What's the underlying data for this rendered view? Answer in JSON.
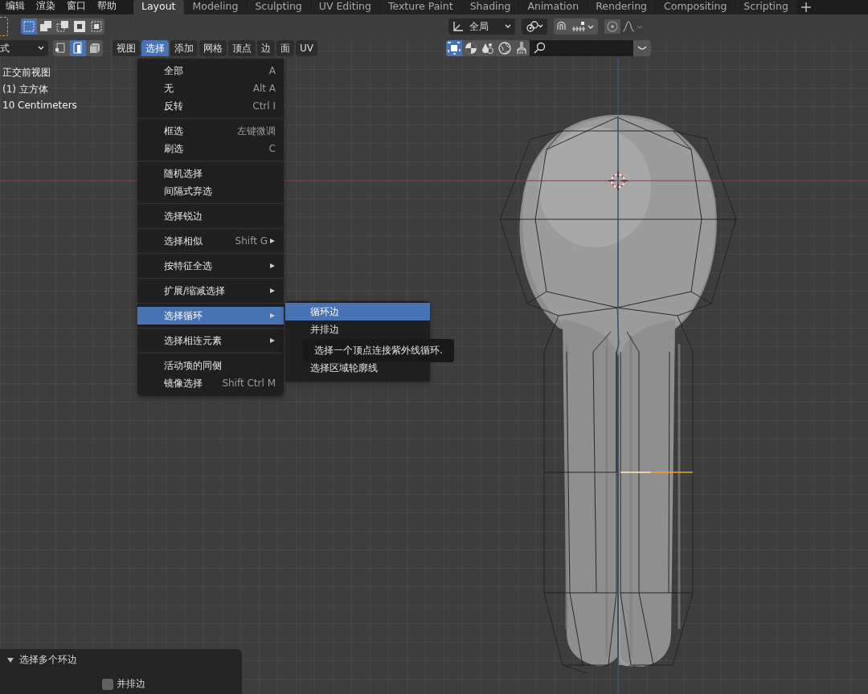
{
  "top_menu": [
    "编辑",
    "渲染",
    "窗口",
    "帮助"
  ],
  "workspace_tabs": [
    {
      "label": "Layout",
      "selected": true
    },
    {
      "label": "Modeling",
      "selected": false
    },
    {
      "label": "Sculpting",
      "selected": false
    },
    {
      "label": "UV Editing",
      "selected": false
    },
    {
      "label": "Texture Paint",
      "selected": false
    },
    {
      "label": "Shading",
      "selected": false
    },
    {
      "label": "Animation",
      "selected": false
    },
    {
      "label": "Rendering",
      "selected": false
    },
    {
      "label": "Compositing",
      "selected": false
    },
    {
      "label": "Scripting",
      "selected": false
    }
  ],
  "selection_modes": [
    {
      "kind": "set",
      "selected": true
    },
    {
      "kind": "extend",
      "selected": false
    },
    {
      "kind": "subtract",
      "selected": false
    },
    {
      "kind": "invert",
      "selected": false
    },
    {
      "kind": "intersect",
      "selected": false
    }
  ],
  "transform_orientation": "全局",
  "mode_dropdown": "式",
  "element_modes": [
    {
      "kind": "vertex",
      "selected": false
    },
    {
      "kind": "edge",
      "selected": true
    },
    {
      "kind": "face",
      "selected": false
    }
  ],
  "header_menus": [
    {
      "label": "视图",
      "selected": false
    },
    {
      "label": "选择",
      "selected": true
    },
    {
      "label": "添加",
      "selected": false
    },
    {
      "label": "网格",
      "selected": false
    },
    {
      "label": "顶点",
      "selected": false
    },
    {
      "label": "边",
      "selected": false
    },
    {
      "label": "面",
      "selected": false
    },
    {
      "label": "UV",
      "selected": false
    }
  ],
  "viewport_info": [
    "正交前视图",
    "(1) 立方体",
    "10 Centimeters"
  ],
  "select_menu": {
    "groups": [
      [
        {
          "label": "全部",
          "shortcut": "A"
        },
        {
          "label": "无",
          "shortcut": "Alt A"
        },
        {
          "label": "反转",
          "shortcut": "Ctrl I"
        }
      ],
      [
        {
          "label": "框选",
          "shortcut": "左键微调"
        },
        {
          "label": "刷选",
          "shortcut": "C"
        }
      ],
      [
        {
          "label": "随机选择"
        },
        {
          "label": "间隔式弃选"
        }
      ],
      [
        {
          "label": "选择锐边"
        }
      ],
      [
        {
          "label": "选择相似",
          "shortcut": "Shift G",
          "submenu": true
        }
      ],
      [
        {
          "label": "按特征全选",
          "submenu": true
        }
      ],
      [
        {
          "label": "扩展/缩减选择",
          "submenu": true
        }
      ],
      [
        {
          "label": "选择循环",
          "submenu": true,
          "selected": true
        }
      ],
      [
        {
          "label": "选择相连元素",
          "submenu": true
        }
      ],
      [
        {
          "label": "活动项的同侧"
        },
        {
          "label": "镜像选择",
          "shortcut": "Shift Ctrl M"
        }
      ]
    ]
  },
  "submenu": {
    "items": [
      {
        "label": "循环边",
        "selected": true
      },
      {
        "label": "并排边",
        "selected": false
      },
      {
        "label": "选择区域轮廓线",
        "selected": false
      }
    ]
  },
  "tooltip": "选择一个顶点连接紫外线循环.",
  "operator_panel": {
    "title": "选择多个环边",
    "expanded": true,
    "options": [
      {
        "label": "并排边",
        "checked": false
      }
    ]
  }
}
